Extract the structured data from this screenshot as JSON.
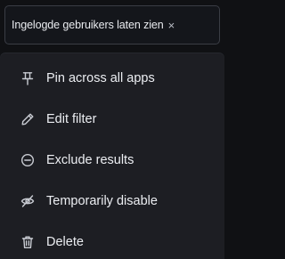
{
  "filter_pill": {
    "label": "Ingelogde gebruikers laten zien",
    "close_glyph": "×"
  },
  "menu": {
    "items": [
      {
        "label": "Pin across all apps",
        "icon": "pin-icon"
      },
      {
        "label": "Edit filter",
        "icon": "pencil-icon"
      },
      {
        "label": "Exclude results",
        "icon": "minus-circle-icon"
      },
      {
        "label": "Temporarily disable",
        "icon": "eye-slash-icon"
      },
      {
        "label": "Delete",
        "icon": "trash-icon"
      }
    ]
  }
}
